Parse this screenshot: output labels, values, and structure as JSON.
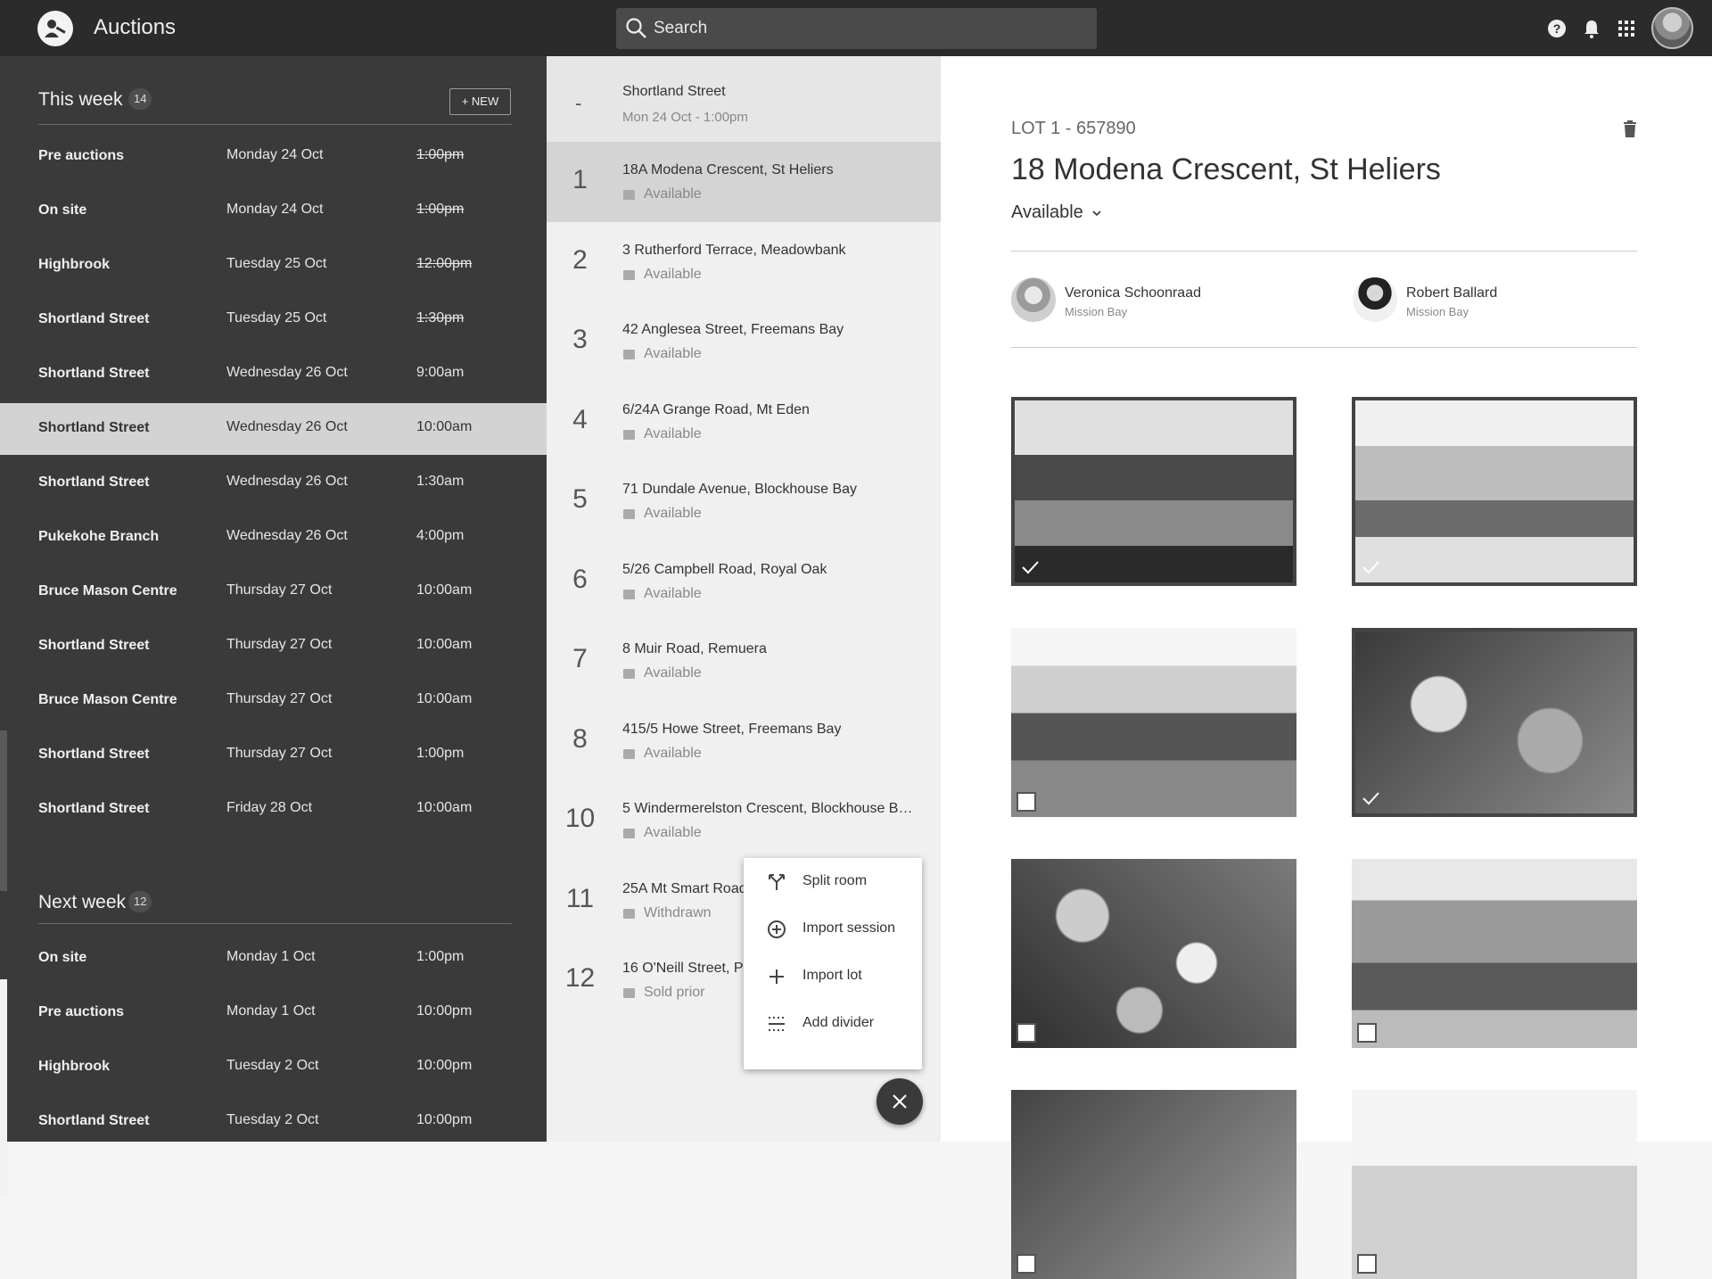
{
  "app": {
    "title": "Auctions"
  },
  "search": {
    "placeholder": "Search"
  },
  "topbar_icons": [
    "help-icon",
    "bell-icon",
    "apps-grid-icon"
  ],
  "sidebar": {
    "this_week": {
      "title": "This week",
      "count": "14",
      "new_label": "+ NEW",
      "rows": [
        {
          "name": "Pre auctions",
          "date": "Monday 24 Oct",
          "time": "1:00pm",
          "past": true
        },
        {
          "name": "On site",
          "date": "Monday 24 Oct",
          "time": "1:00pm",
          "past": true
        },
        {
          "name": "Highbrook",
          "date": "Tuesday 25 Oct",
          "time": "12:00pm",
          "past": true
        },
        {
          "name": "Shortland Street",
          "date": "Tuesday 25 Oct",
          "time": "1:30pm",
          "past": true
        },
        {
          "name": "Shortland Street",
          "date": "Wednesday 26 Oct",
          "time": "9:00am",
          "past": false
        },
        {
          "name": "Shortland Street",
          "date": "Wednesday 26 Oct",
          "time": "10:00am",
          "past": false,
          "selected": true
        },
        {
          "name": "Shortland Street",
          "date": "Wednesday 26 Oct",
          "time": "1:30am",
          "past": false
        },
        {
          "name": "Pukekohe Branch",
          "date": "Wednesday 26 Oct",
          "time": "4:00pm",
          "past": false
        },
        {
          "name": "Bruce Mason Centre",
          "date": "Thursday 27 Oct",
          "time": "10:00am",
          "past": false
        },
        {
          "name": "Shortland Street",
          "date": "Thursday 27 Oct",
          "time": "10:00am",
          "past": false
        },
        {
          "name": "Bruce Mason Centre",
          "date": "Thursday 27 Oct",
          "time": "10:00am",
          "past": false
        },
        {
          "name": "Shortland Street",
          "date": "Thursday 27 Oct",
          "time": "1:00pm",
          "past": false
        },
        {
          "name": "Shortland Street",
          "date": "Friday 28 Oct",
          "time": "10:00am",
          "past": false
        }
      ]
    },
    "next_week": {
      "title": "Next week",
      "count": "12",
      "rows": [
        {
          "name": "On site",
          "date": "Monday 1 Oct",
          "time": "1:00pm"
        },
        {
          "name": "Pre auctions",
          "date": "Monday 1 Oct",
          "time": "10:00pm"
        },
        {
          "name": "Highbrook",
          "date": "Tuesday 2 Oct",
          "time": "10:00pm"
        },
        {
          "name": "Shortland Street",
          "date": "Tuesday 2 Oct",
          "time": "10:00pm"
        }
      ]
    }
  },
  "session": {
    "marker": "-",
    "title": "Shortland Street",
    "subtitle": "Mon 24 Oct - 1:00pm",
    "lots": [
      {
        "num": "1",
        "address": "18A Modena Crescent, St Heliers",
        "status": "Available",
        "selected": true
      },
      {
        "num": "2",
        "address": "3 Rutherford Terrace, Meadowbank",
        "status": "Available"
      },
      {
        "num": "3",
        "address": "42 Anglesea Street, Freemans Bay",
        "status": "Available"
      },
      {
        "num": "4",
        "address": "6/24A Grange Road, Mt Eden",
        "status": "Available"
      },
      {
        "num": "5",
        "address": "71 Dundale Avenue, Blockhouse Bay",
        "status": "Available"
      },
      {
        "num": "6",
        "address": "5/26 Campbell Road, Royal Oak",
        "status": "Available"
      },
      {
        "num": "7",
        "address": "8 Muir Road, Remuera",
        "status": "Available"
      },
      {
        "num": "8",
        "address": "415/5 Howe Street, Freemans Bay",
        "status": "Available"
      },
      {
        "num": "10",
        "address": "5 Windermerelston Crescent, Blockhouse B…",
        "status": "Available"
      },
      {
        "num": "11",
        "address": "25A Mt Smart Road",
        "status": "Withdrawn"
      },
      {
        "num": "12",
        "address": "16 O'Neill Street, P",
        "status": "Sold prior"
      }
    ]
  },
  "menu": {
    "items": [
      {
        "label": "Split room",
        "icon": "split-icon"
      },
      {
        "label": "Import session",
        "icon": "add-circle-icon"
      },
      {
        "label": "Import lot",
        "icon": "plus-icon"
      },
      {
        "label": "Add divider",
        "icon": "divider-icon"
      }
    ]
  },
  "detail": {
    "lot_label": "LOT 1 - 657890",
    "title": "18 Modena Crescent, St Heliers",
    "status": "Available",
    "agents": [
      {
        "name": "Veronica Schoonraad",
        "office": "Mission Bay"
      },
      {
        "name": "Robert Ballard",
        "office": "Mission Bay"
      }
    ],
    "photos": [
      {
        "desc": "house-exterior-photo",
        "selected": true
      },
      {
        "desc": "house-front-photo",
        "selected": true
      },
      {
        "desc": "living-room-photo",
        "selected": false
      },
      {
        "desc": "aerial-photo",
        "selected": true
      },
      {
        "desc": "aerial-neighbourhood-photo",
        "selected": false
      },
      {
        "desc": "interior-kitchen-photo",
        "selected": false
      },
      {
        "desc": "aerial-photo-2",
        "selected": false
      },
      {
        "desc": "interior-photo-2",
        "selected": false
      }
    ]
  }
}
